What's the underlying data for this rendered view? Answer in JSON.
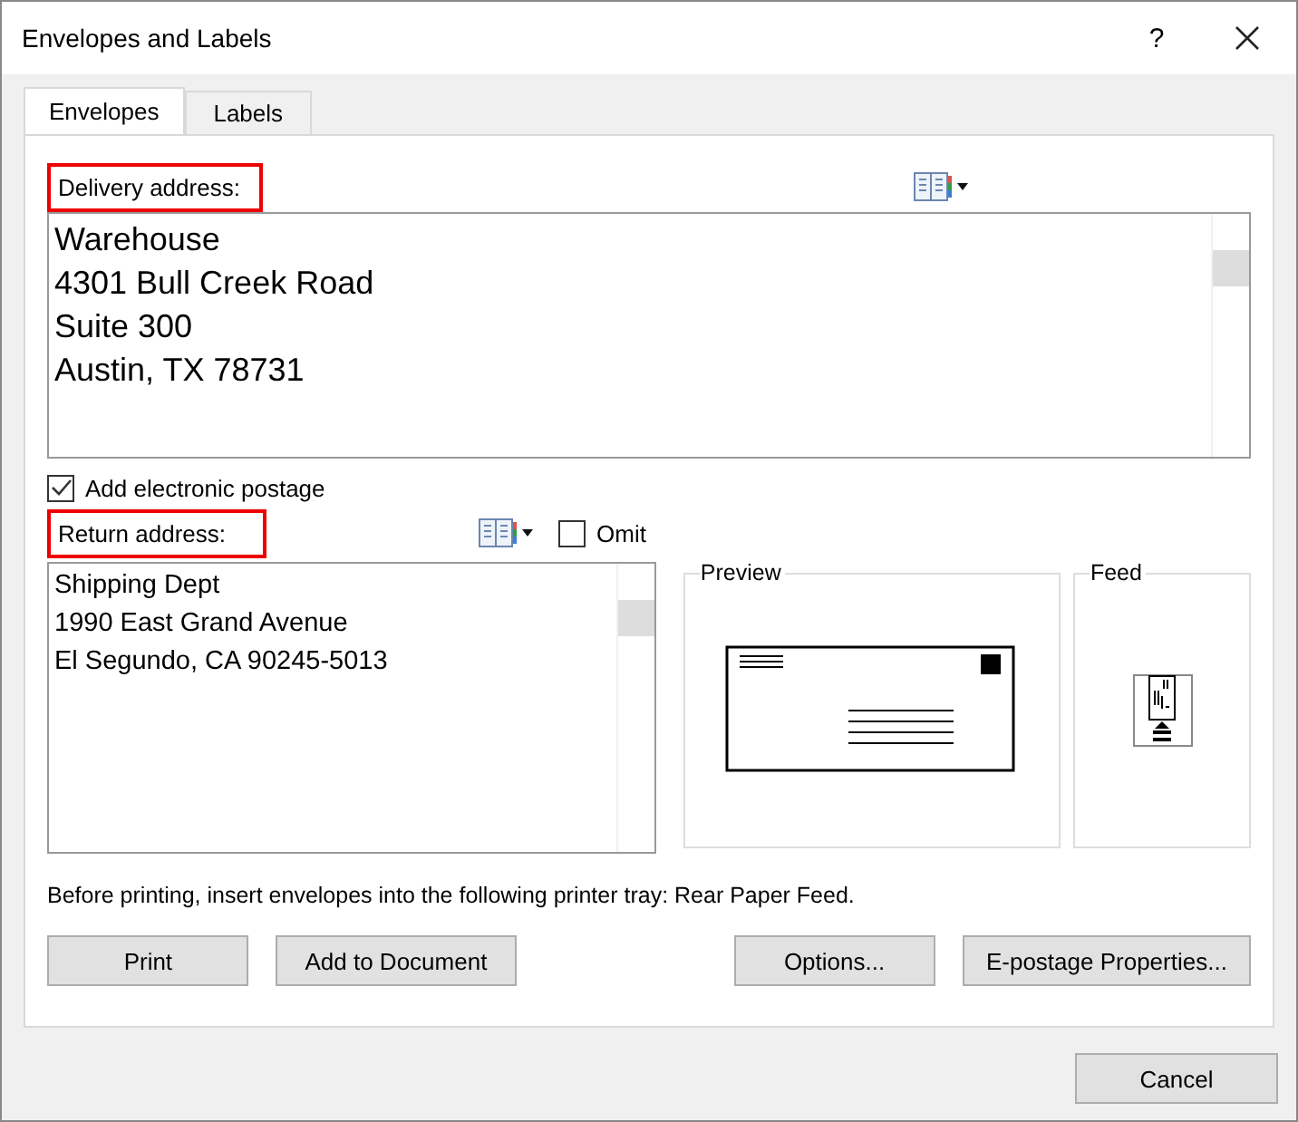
{
  "window": {
    "title": "Envelopes and Labels",
    "help": "?"
  },
  "tabs": [
    {
      "label": "Envelopes",
      "selected": true
    },
    {
      "label": "Labels",
      "selected": false
    }
  ],
  "delivery_address": {
    "label": "Delivery address:",
    "highlighted": true,
    "lines": [
      "Warehouse",
      "4301 Bull Creek Road",
      "Suite 300",
      "Austin, TX 78731"
    ]
  },
  "electronic_postage": {
    "label": "Add electronic postage",
    "checked": true
  },
  "return_address": {
    "label": "Return address:",
    "highlighted": true,
    "lines": [
      "Shipping Dept",
      "1990 East Grand Avenue",
      "El Segundo, CA 90245-5013"
    ]
  },
  "omit": {
    "label": "Omit",
    "checked": false
  },
  "preview": {
    "label": "Preview"
  },
  "feed": {
    "label": "Feed"
  },
  "tray_note": "Before printing, insert envelopes into the following printer tray: Rear Paper Feed.",
  "buttons": [
    {
      "label": "Print"
    },
    {
      "label": "Add to Document"
    },
    {
      "label": "Options..."
    },
    {
      "label": "E-postage Properties..."
    }
  ],
  "cancel": "Cancel"
}
